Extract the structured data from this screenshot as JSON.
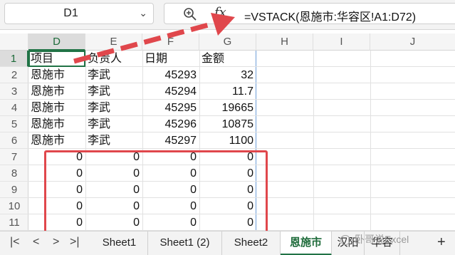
{
  "namebox": {
    "value": "D1",
    "chevron_icon": "chevron-down-icon"
  },
  "formula_bar": {
    "zoom_icon": "zoom-in-icon",
    "fx_label": "fx",
    "formula": "=VSTACK(恩施市:华容区!A1:D72)"
  },
  "columns": [
    "D",
    "E",
    "F",
    "G",
    "H",
    "I",
    "J"
  ],
  "rows": [
    "1",
    "2",
    "3",
    "4",
    "5",
    "6",
    "7",
    "8",
    "9",
    "10",
    "11"
  ],
  "table": {
    "headers": [
      "项目",
      "负责人",
      "日期",
      "金额"
    ],
    "rows": [
      [
        "恩施市",
        "李武",
        "45293",
        "32"
      ],
      [
        "恩施市",
        "李武",
        "45294",
        "11.7"
      ],
      [
        "恩施市",
        "李武",
        "45295",
        "19665"
      ],
      [
        "恩施市",
        "李武",
        "45296",
        "10875"
      ],
      [
        "恩施市",
        "李武",
        "45297",
        "1100"
      ],
      [
        "0",
        "0",
        "0",
        "0"
      ],
      [
        "0",
        "0",
        "0",
        "0"
      ],
      [
        "0",
        "0",
        "0",
        "0"
      ],
      [
        "0",
        "0",
        "0",
        "0"
      ],
      [
        "0",
        "0",
        "0",
        "0"
      ]
    ]
  },
  "sheet_tabs": [
    "Sheet1",
    "Sheet1 (2)",
    "Sheet2",
    "恩施市",
    "汉阳",
    "华容"
  ],
  "active_tab": "恩施市",
  "add_sheet_label": "+",
  "nav": [
    "K",
    "<",
    ">",
    ">|"
  ],
  "watermark": "卧哥说Excel",
  "colors": {
    "accent": "#217346",
    "annotation": "#e0474c",
    "spill_border": "#6f9fd8"
  }
}
